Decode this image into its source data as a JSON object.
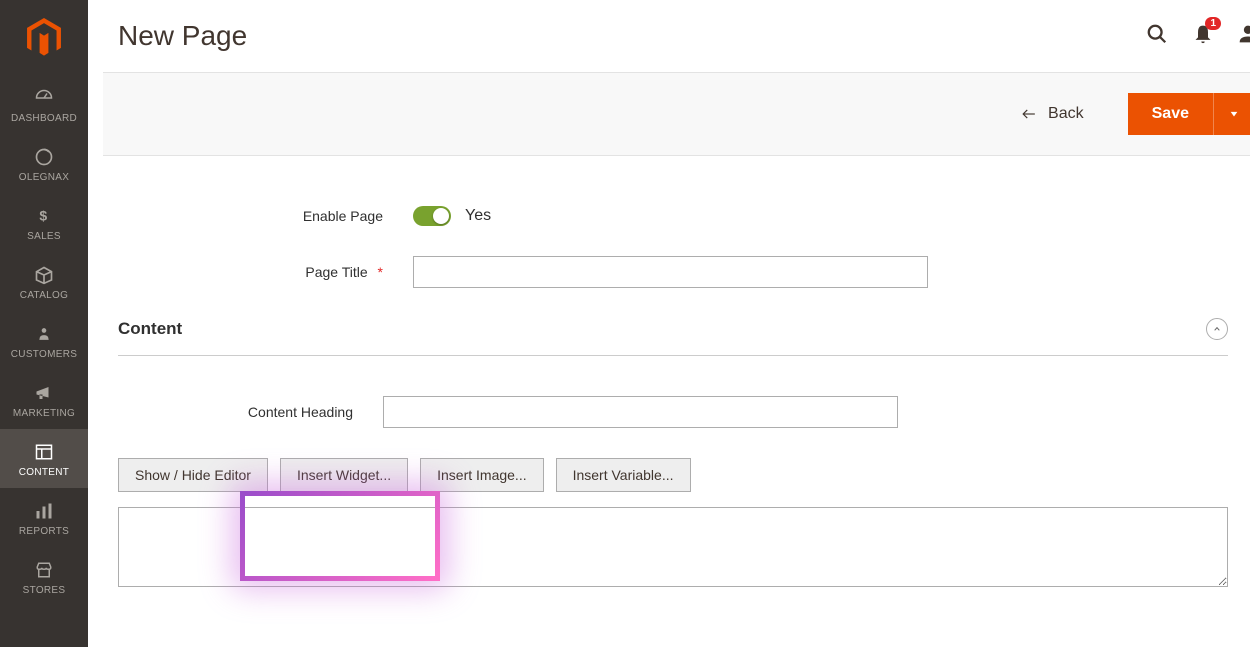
{
  "header": {
    "title": "New Page"
  },
  "notifications": {
    "count": "1"
  },
  "sidebar": {
    "items": [
      {
        "label": "DASHBOARD"
      },
      {
        "label": "OLEGNAX"
      },
      {
        "label": "SALES"
      },
      {
        "label": "CATALOG"
      },
      {
        "label": "CUSTOMERS"
      },
      {
        "label": "MARKETING"
      },
      {
        "label": "CONTENT"
      },
      {
        "label": "REPORTS"
      },
      {
        "label": "STORES"
      }
    ]
  },
  "actions": {
    "back": "Back",
    "save": "Save"
  },
  "form": {
    "enable_label": "Enable Page",
    "enable_value": "Yes",
    "title_label": "Page Title",
    "title_value": ""
  },
  "content_section": {
    "title": "Content",
    "heading_label": "Content Heading",
    "heading_value": "",
    "buttons": {
      "toggle_editor": "Show / Hide Editor",
      "insert_widget": "Insert Widget...",
      "insert_image": "Insert Image...",
      "insert_variable": "Insert Variable..."
    },
    "body": ""
  }
}
